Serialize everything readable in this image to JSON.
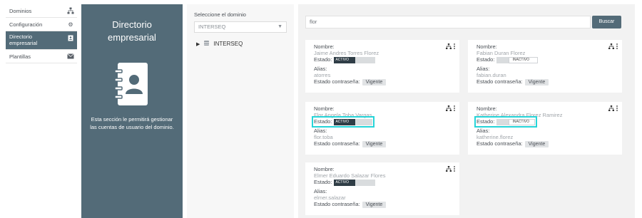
{
  "nav": {
    "items": [
      {
        "label": "Dominios",
        "icon": "sitemap-icon"
      },
      {
        "label": "Configuración",
        "icon": "gear-icon"
      },
      {
        "label": "Directorio empresarial",
        "icon": "contact-book-icon"
      },
      {
        "label": "Plantillas",
        "icon": "envelope-icon"
      }
    ]
  },
  "hero": {
    "title": "Directorio empresarial",
    "description": "Esta sección le permitirá gestionar las cuentas de usuario del dominio."
  },
  "domain": {
    "label": "Seleccione el dominio",
    "selected": "INTERSEQ",
    "tree_root": "INTERSEQ"
  },
  "search": {
    "value": "flor",
    "button": "Buscar"
  },
  "labels": {
    "name": "Nombre:",
    "state": "Estado:",
    "alias": "Alias:",
    "password_state": "Estado contraseña:"
  },
  "cards": [
    {
      "name": "Jaime Andres Torres Florez",
      "state": "ACTIVO",
      "active": true,
      "alias": "atorres",
      "password": "Vigente"
    },
    {
      "name": "Fabian Duran Florez",
      "state": "INACTIVO",
      "active": false,
      "alias": "fabian.duran",
      "password": "Vigente"
    },
    {
      "name": "Flor Angela Toba Vargas",
      "state": "ACTIVO",
      "active": true,
      "alias": "flor.toba",
      "password": "Vigente"
    },
    {
      "name": "Katherine Alexandra Florez Ramirez",
      "state": "INACTIVO",
      "active": false,
      "alias": "katherine.florez",
      "password": "Vigente"
    },
    {
      "name": "Elmer Eduardo Salazar Flores",
      "state": "ACTIVO",
      "active": true,
      "alias": "elmer.salazar",
      "password": "Vigente"
    }
  ],
  "colors": {
    "accent": "#536b78",
    "highlight": "#26d4d8"
  }
}
